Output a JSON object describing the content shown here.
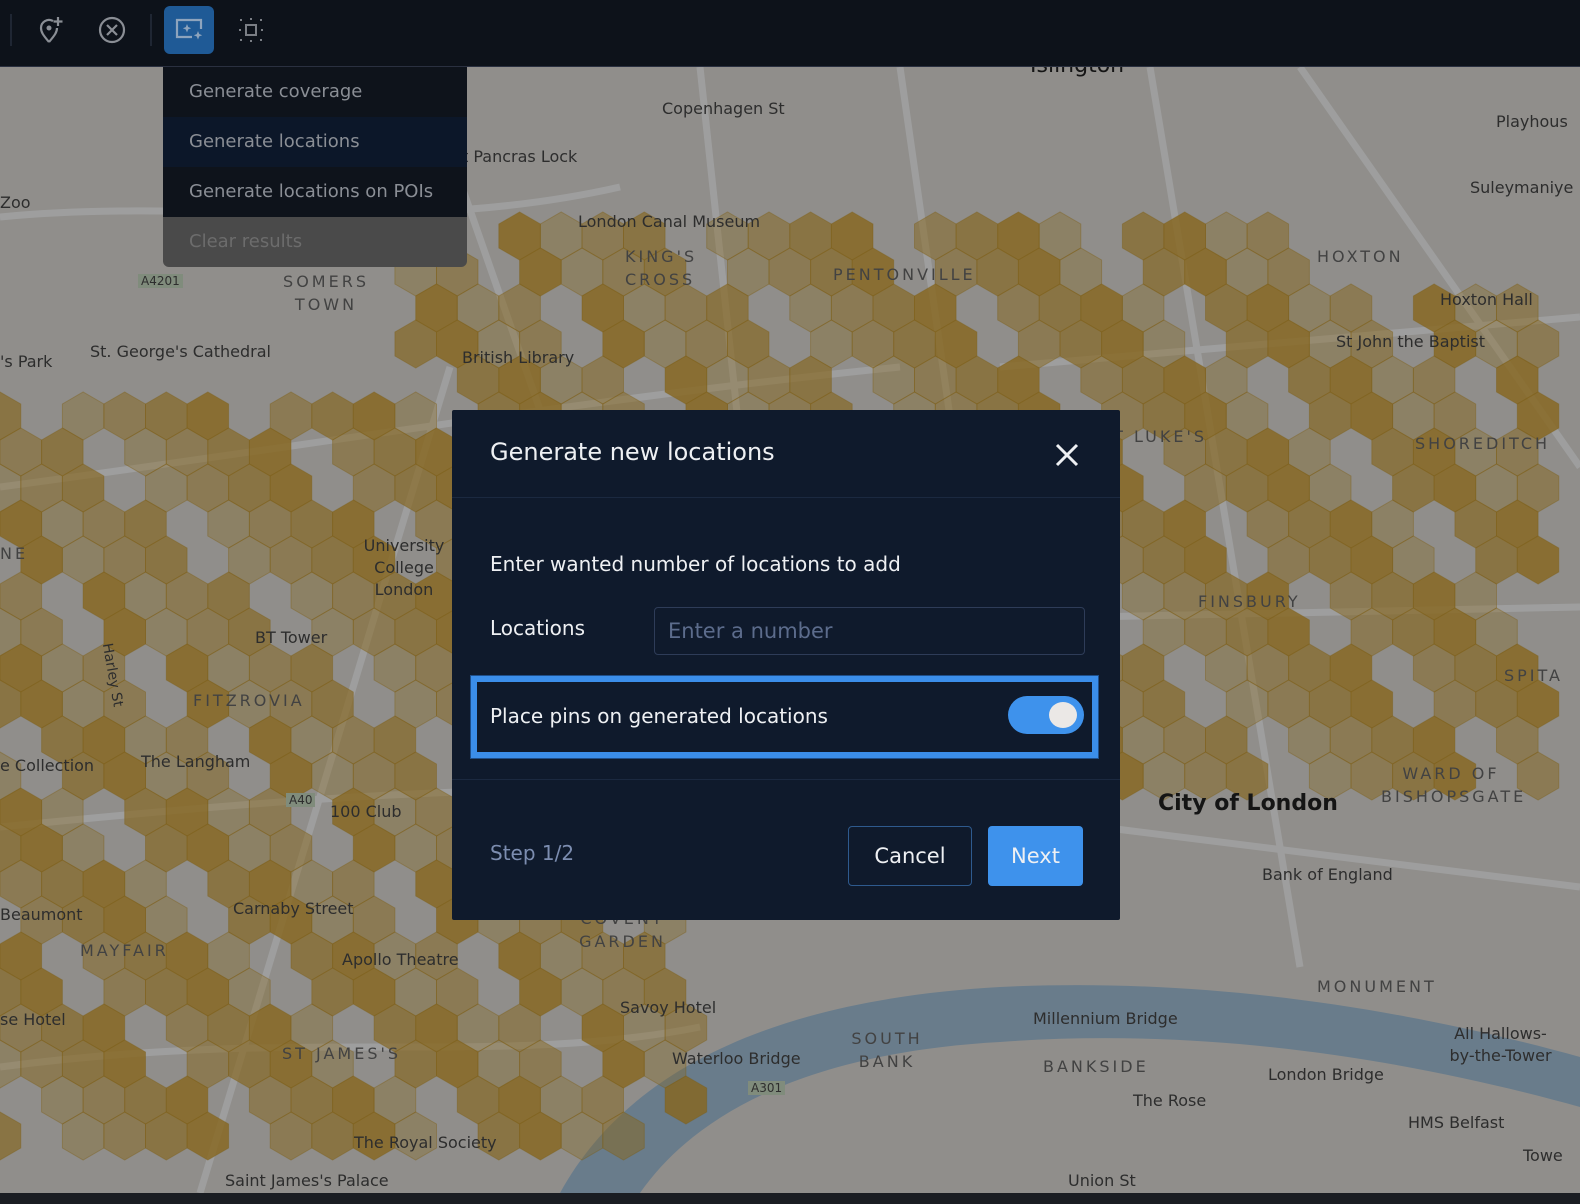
{
  "toolbar": {
    "buttons": [
      {
        "icon": "add-pin-icon"
      },
      {
        "icon": "clear-circle-icon"
      },
      {
        "icon": "generate-sparkle-icon",
        "active": true
      },
      {
        "icon": "select-area-icon"
      }
    ],
    "accent": "#1f5a96"
  },
  "menu": {
    "items": [
      {
        "label": "Generate coverage"
      },
      {
        "label": "Generate locations"
      },
      {
        "label": "Generate locations on POIs"
      },
      {
        "label": "Clear results"
      }
    ]
  },
  "map": {
    "labels": [
      "Copenhagen St",
      "t Pancras Lock",
      "London Canal Museum",
      "KING'S CROSS",
      "PENTONVILLE",
      "HOXTON",
      "Hoxton Hall",
      "St John the Baptist",
      "Playhous",
      "Suleymaniye",
      "Zoo",
      "A4201",
      "SOMERS TOWN",
      "St. George's Cathedral",
      "'s Park",
      "British Library",
      "ST LUKE'S",
      "SHOREDITCH",
      "NE",
      "University College London",
      "BT Tower",
      "FINSBURY",
      "SPITA",
      "FITZROVIA",
      "Harley St",
      "The Langham",
      "e Collection",
      "100 Club",
      "City of London",
      "WARD OF BISHOPSGATE",
      "Bank of England",
      "Beaumont",
      "Carnaby Street",
      "MAYFAIR",
      "Apollo Theatre",
      "COVENT GARDEN",
      "Savoy Hotel",
      "MONUMENT",
      "Millennium Bridge",
      "All Hallows-by-the-Tower",
      "se Hotel",
      "ST JAMES'S",
      "Waterloo Bridge",
      "SOUTH BANK",
      "BANKSIDE",
      "London Bridge",
      "The Rose",
      "HMS Belfast",
      "The Royal Society",
      "Towe",
      "Saint James's Palace",
      "Union St",
      "A40",
      "A301",
      "Islington"
    ],
    "hex_color": "#d9a530"
  },
  "modal": {
    "title": "Generate new locations",
    "description": "Enter wanted number of locations to add",
    "locations_label": "Locations",
    "locations_value": "",
    "locations_placeholder": "Enter a number",
    "toggle_label": "Place pins on generated locations",
    "toggle_on": true,
    "step": "Step 1/2",
    "cancel": "Cancel",
    "next": "Next",
    "primary_color": "#3e92ec"
  }
}
